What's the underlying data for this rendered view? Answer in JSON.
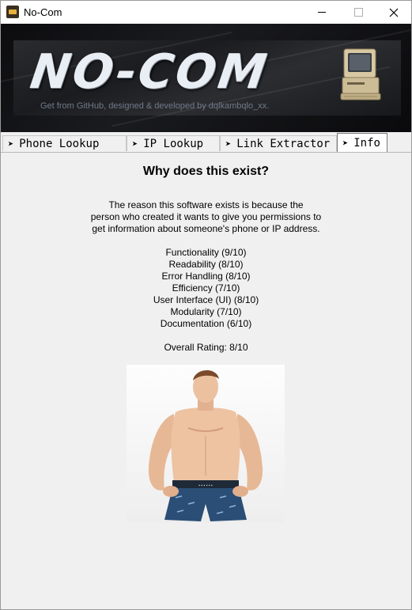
{
  "window": {
    "title": "No-Com",
    "icon": "app-icon"
  },
  "banner": {
    "logo_text": "NO-COM",
    "tagline": "Get from GitHub, designed & developed by dqlkambqlo_xx.",
    "icon": "retro-computer-icon"
  },
  "tabs": [
    {
      "label": "Phone Lookup",
      "icon": "arrow-icon",
      "active": false
    },
    {
      "label": "IP Lookup",
      "icon": "arrow-icon",
      "active": false
    },
    {
      "label": "Link Extractor",
      "icon": "arrow-icon",
      "active": false
    },
    {
      "label": "Info",
      "icon": "arrow-icon",
      "active": true
    }
  ],
  "info": {
    "heading": "Why does this exist?",
    "paragraph": [
      "The reason this software exists is because the",
      "person who created it wants to give you permissions to",
      "get information about someone's phone or IP address."
    ],
    "ratings": [
      "Functionality (9/10)",
      "Readability (8/10)",
      "Error Handling (8/10)",
      "Efficiency (7/10)",
      "User Interface (UI) (8/10)",
      "Modularity (7/10)",
      "Documentation (6/10)"
    ],
    "overall": "Overall Rating: 8/10"
  },
  "colors": {
    "banner_bg": "#141518",
    "logo": "#e9eef4",
    "tagline": "#6f7a8a"
  }
}
